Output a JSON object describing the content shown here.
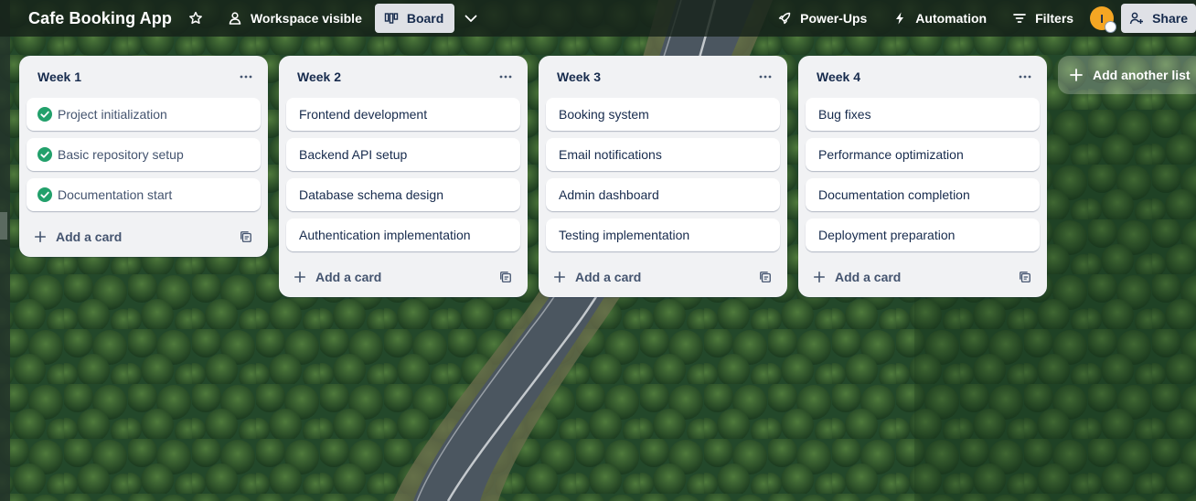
{
  "header": {
    "board_title": "Cafe Booking App",
    "star_icon": "star-icon",
    "visibility_label": "Workspace visible",
    "view_label": "Board",
    "powerups_label": "Power-Ups",
    "automation_label": "Automation",
    "filters_label": "Filters",
    "avatar_initial": "I",
    "share_label": "Share"
  },
  "lists": [
    {
      "title": "Week 1",
      "cards": [
        {
          "title": "Project initialization",
          "done": true
        },
        {
          "title": "Basic repository setup",
          "done": true
        },
        {
          "title": "Documentation start",
          "done": true
        }
      ],
      "add_card_label": "Add a card"
    },
    {
      "title": "Week 2",
      "cards": [
        {
          "title": "Frontend development",
          "done": false
        },
        {
          "title": "Backend API setup",
          "done": false
        },
        {
          "title": "Database schema design",
          "done": false
        },
        {
          "title": "Authentication implementation",
          "done": false
        }
      ],
      "add_card_label": "Add a card"
    },
    {
      "title": "Week 3",
      "cards": [
        {
          "title": "Booking system",
          "done": false
        },
        {
          "title": "Email notifications",
          "done": false
        },
        {
          "title": "Admin dashboard",
          "done": false
        },
        {
          "title": "Testing implementation",
          "done": false
        }
      ],
      "add_card_label": "Add a card"
    },
    {
      "title": "Week 4",
      "cards": [
        {
          "title": "Bug fixes",
          "done": false
        },
        {
          "title": "Performance optimization",
          "done": false
        },
        {
          "title": "Documentation completion",
          "done": false
        },
        {
          "title": "Deployment preparation",
          "done": false
        }
      ],
      "add_card_label": "Add a card"
    }
  ],
  "add_list_label": "Add another list",
  "colors": {
    "done_check": "#22a06b",
    "list_bg": "#f1f2f4",
    "text": "#172b4d",
    "avatar": "#f5a623"
  }
}
